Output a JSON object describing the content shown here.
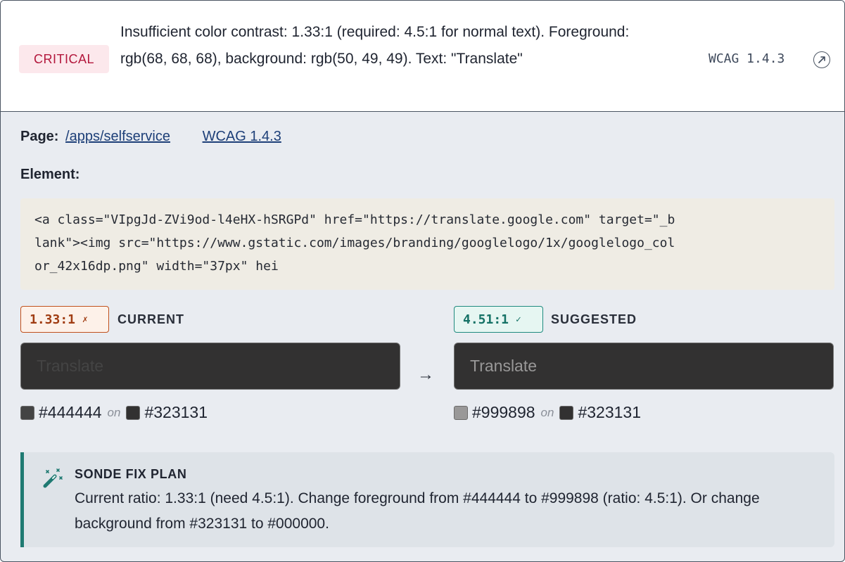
{
  "issue": {
    "severity": "CRITICAL",
    "description": "Insufficient color contrast: 1.33:1 (required: 4.5:1 for normal text). Foreground: rgb(68, 68, 68), background: rgb(50, 49, 49). Text: \"Translate\"",
    "wcag_code": "WCAG 1.4.3",
    "external_link_icon": "external-link-icon"
  },
  "meta": {
    "page_label": "Page:",
    "page_link": "/apps/selfservice",
    "wcag_link": "WCAG 1.4.3"
  },
  "element": {
    "label": "Element:",
    "code": "<a class=\"VIpgJd-ZVi9od-l4eHX-hSRGPd\" href=\"https://translate.google.com\" target=\"_b\nlank\"><img src=\"https://www.gstatic.com/images/branding/googlelogo/1x/googlelogo_col\nor_42x16dp.png\" width=\"37px\" hei"
  },
  "current": {
    "ratio": "1.33:1",
    "status_mark": "✗",
    "caption": "CURRENT",
    "sample_text": "Translate",
    "foreground": "#444444",
    "on_word": "on",
    "background": "#323131"
  },
  "suggested": {
    "ratio": "4.51:1",
    "status_mark": "✓",
    "caption": "SUGGESTED",
    "sample_text": "Translate",
    "foreground": "#999898",
    "on_word": "on",
    "background": "#323131"
  },
  "arrow": "→",
  "fix_plan": {
    "title": "SONDE FIX PLAN",
    "icon": "magic-wand-icon",
    "body": "Current ratio: 1.33:1 (need 4.5:1). Change foreground from #444444 to #999898 (ratio: 4.5:1). Or change background from #323131 to #000000."
  },
  "colors": {
    "critical_text": "#b3173c",
    "critical_bg": "#fce8ec",
    "fail_accent": "#c0501c",
    "pass_accent": "#1f8a7f",
    "fix_accent": "#1f7a72"
  }
}
